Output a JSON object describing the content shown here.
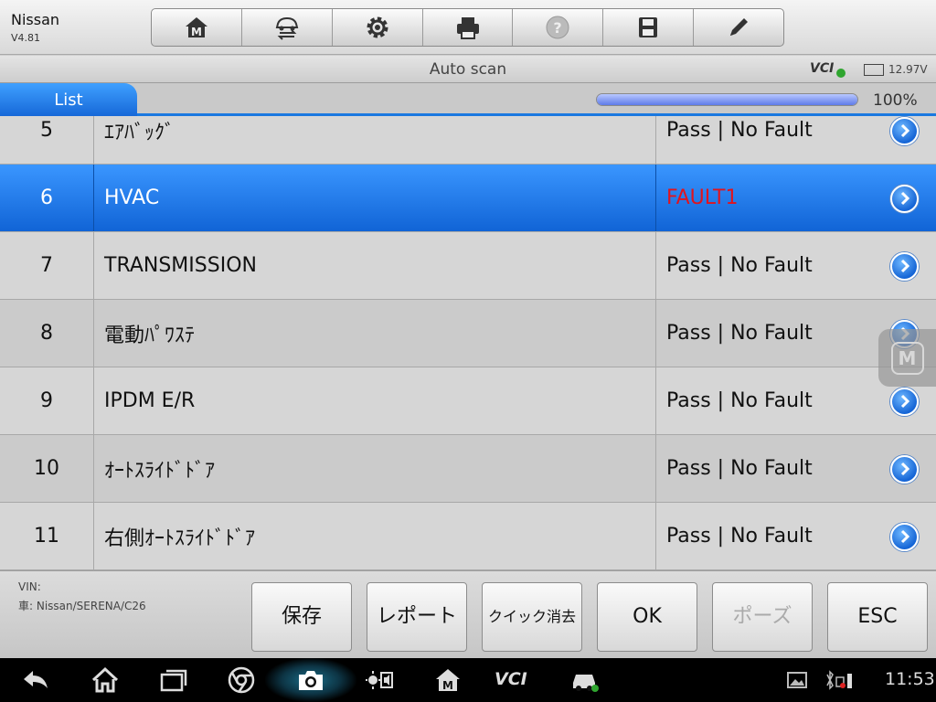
{
  "header": {
    "brand": "Nissan",
    "version": "V4.81",
    "toolbar": [
      {
        "name": "home-icon"
      },
      {
        "name": "vehicle-swap-icon"
      },
      {
        "name": "settings-gear-icon"
      },
      {
        "name": "printer-icon"
      },
      {
        "name": "help-icon"
      },
      {
        "name": "save-disk-icon"
      },
      {
        "name": "pencil-icon"
      }
    ]
  },
  "titlebar": {
    "title": "Auto scan",
    "vci": "VCI",
    "voltage": "12.97V"
  },
  "tab": {
    "label": "List",
    "progress_percent": 100,
    "progress_text": "100%"
  },
  "rows": [
    {
      "num": "5",
      "name": "ｴｱﾊﾞｯｸﾞ",
      "status": "Pass | No Fault",
      "fault": false,
      "selected": false
    },
    {
      "num": "6",
      "name": "HVAC",
      "status": "FAULT1",
      "fault": true,
      "selected": true
    },
    {
      "num": "7",
      "name": "TRANSMISSION",
      "status": "Pass | No Fault",
      "fault": false,
      "selected": false
    },
    {
      "num": "8",
      "name": "電動ﾊﾟﾜｽﾃ",
      "status": "Pass | No Fault",
      "fault": false,
      "selected": false
    },
    {
      "num": "9",
      "name": "IPDM E/R",
      "status": "Pass | No Fault",
      "fault": false,
      "selected": false
    },
    {
      "num": "10",
      "name": "ｵｰﾄｽﾗｲﾄﾞﾄﾞｱ",
      "status": "Pass | No Fault",
      "fault": false,
      "selected": false
    },
    {
      "num": "11",
      "name": "右側ｵｰﾄｽﾗｲﾄﾞﾄﾞｱ",
      "status": "Pass | No Fault",
      "fault": false,
      "selected": false
    }
  ],
  "footer": {
    "vin_label": "VIN:",
    "car_label": "車: Nissan/SERENA/C26",
    "buttons": {
      "save": "保存",
      "report": "レポート",
      "quick_clear": "クイック消去",
      "ok": "OK",
      "pause": "ポーズ",
      "esc": "ESC"
    }
  },
  "navbar": {
    "vci": "VCI",
    "clock": "11:53"
  },
  "colors": {
    "accent": "#1a78e0",
    "fault": "#e0141e",
    "vci_ok": "#2fa52f"
  }
}
